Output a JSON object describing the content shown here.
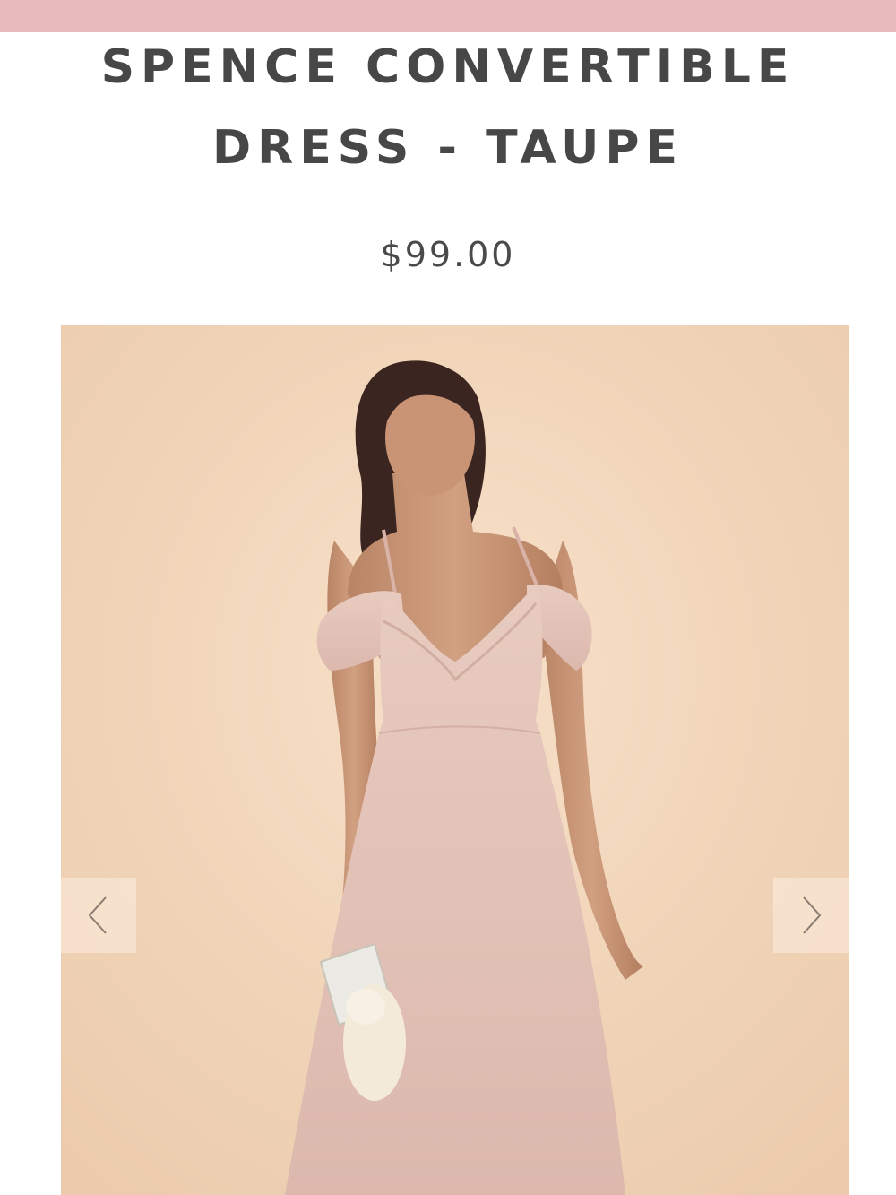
{
  "header": {
    "accent_color": "#e6b9bd"
  },
  "product": {
    "title_line1": "SPENCE CONVERTIBLE",
    "title_line2": "DRESS - TAUPE",
    "price": "$99.00"
  },
  "gallery": {
    "background_color": "#f2d6bb",
    "dress_color": "#e3c2b8",
    "prev_icon": "chevron-left-icon",
    "next_icon": "chevron-right-icon"
  }
}
